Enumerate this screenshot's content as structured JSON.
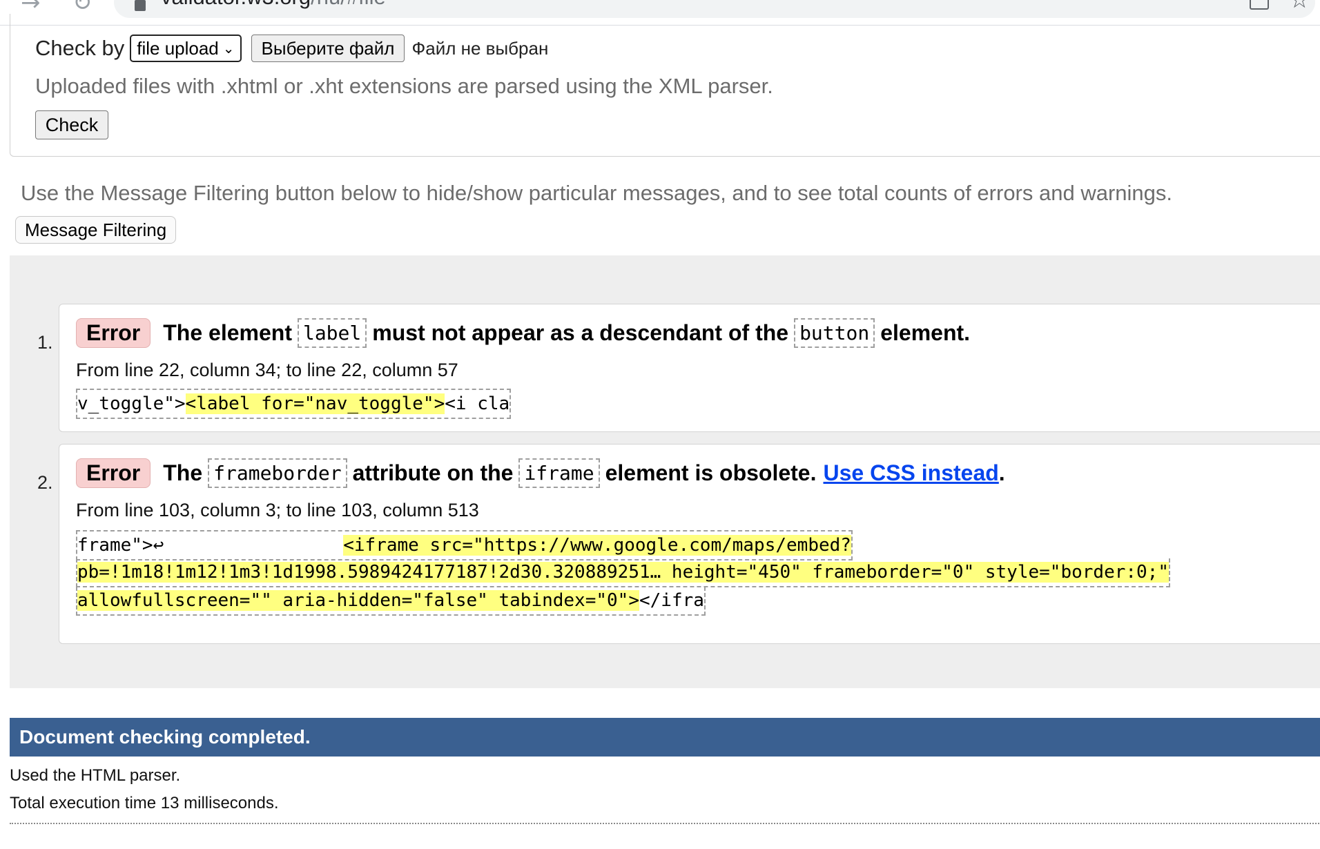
{
  "browser": {
    "url_host": "validator.w3.org",
    "url_path": "/nu/#file"
  },
  "check_by": {
    "label": "Check by",
    "select_value": "file upload",
    "file_button_label": "Выберите файл",
    "file_status": "Файл не выбран",
    "xml_note": "Uploaded files with .xhtml or .xht extensions are parsed using the XML parser.",
    "check_button_label": "Check"
  },
  "filtering": {
    "note": "Use the Message Filtering button below to hide/show particular messages, and to see total counts of errors and warnings.",
    "button_label": "Message Filtering"
  },
  "messages": [
    {
      "number": "1.",
      "type": "Error",
      "text_a": "The element",
      "code_a": "label",
      "text_b": "must not appear as a descendant of the",
      "code_b": "button",
      "text_c": "element.",
      "location": "From line 22, column 34; to line 22, column 57",
      "extract_pre": "v_toggle\">",
      "extract_hl": "<label for=\"nav_toggle\">",
      "extract_post": "<i cla"
    },
    {
      "number": "2.",
      "type": "Error",
      "text_a": "The",
      "code_a": "frameborder",
      "text_b": "attribute on the",
      "code_b": "iframe",
      "text_c": "element is obsolete.",
      "link": "Use CSS instead",
      "link_after": ".",
      "location": "From line 103, column 3; to line 103, column 513",
      "extract_line1_pre": "frame\">↩",
      "extract_line1_hl": "<iframe src=\"https://www.google.com/maps/embed?",
      "extract_line2_hl": "pb=!1m18!1m12!1m3!1d1998.5989424177187!2d30.320889251… height=\"450\" frameborder=\"0\" style=\"border:0;\"",
      "extract_line3_hl": "allowfullscreen=\"\" aria-hidden=\"false\" tabindex=\"0\">",
      "extract_line3_post": "</ifra"
    }
  ],
  "completion": {
    "title": "Document checking completed.",
    "parser_note": "Used the HTML parser.",
    "exec_note": "Total execution time 13 milliseconds."
  }
}
